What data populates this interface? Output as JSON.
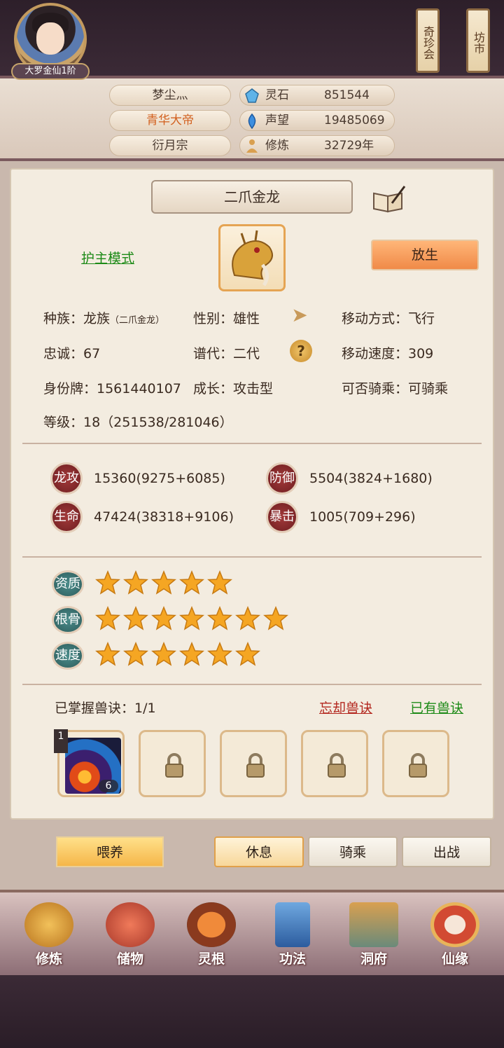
{
  "header": {
    "rank": "大罗金仙1阶",
    "player_name": "梦尘灬",
    "title": "青华大帝",
    "sect": "衍月宗",
    "resources": [
      {
        "label": "灵石",
        "value": "851544",
        "icon": "spirit-stone-icon",
        "color": "#5fb3e8"
      },
      {
        "label": "声望",
        "value": "19485069",
        "icon": "prestige-icon",
        "color": "#3d8fe0"
      },
      {
        "label": "修炼",
        "value": "32729年",
        "icon": "meditation-icon",
        "color": "#d9a050"
      }
    ],
    "shop_buttons": [
      "奇珍会",
      "坊市"
    ]
  },
  "pet": {
    "name": "二爪金龙",
    "mode_link": "护主模式",
    "release_label": "放生",
    "info": {
      "race": "种族：龙族",
      "race_detail": "（二爪金龙）",
      "gender": "性别：雄性",
      "move_type": "移动方式：飞行",
      "loyalty": "忠诚：67",
      "generation": "谱代：二代",
      "move_speed": "移动速度：309",
      "id_tag": "身份牌：1561440107",
      "growth": "成长：攻击型",
      "rideable": "可否骑乘：可骑乘",
      "level": "等级：18（251538/281046）"
    },
    "stats": [
      {
        "label": "龙攻",
        "value": "15360(9275+6085)"
      },
      {
        "label": "防御",
        "value": "5504(3824+1680)"
      },
      {
        "label": "生命",
        "value": "47424(38318+9106)"
      },
      {
        "label": "暴击",
        "value": "1005(709+296)"
      }
    ],
    "attributes": [
      {
        "label": "资质",
        "stars": 5
      },
      {
        "label": "根骨",
        "stars": 7
      },
      {
        "label": "速度",
        "stars": 6
      }
    ],
    "skills": {
      "mastered_label": "已掌握兽诀：1/1",
      "forget_link": "忘却兽诀",
      "owned_link": "已有兽诀",
      "first_skill_level": "1",
      "first_skill_count": "6"
    }
  },
  "actions": {
    "feed": "喂养",
    "rest": "休息",
    "ride": "骑乘",
    "battle": "出战"
  },
  "nav": [
    "修炼",
    "储物",
    "灵根",
    "功法",
    "洞府",
    "仙缘"
  ]
}
